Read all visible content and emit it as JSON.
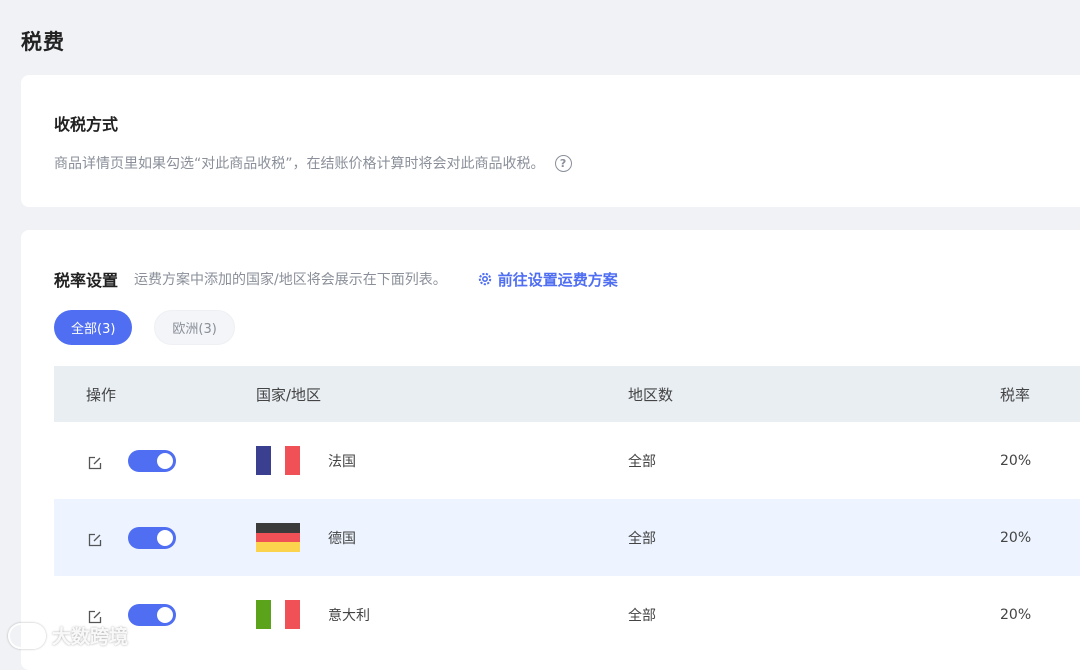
{
  "page": {
    "title": "税费"
  },
  "tax_method": {
    "title": "收税方式",
    "description": "商品详情页里如果勾选“对此商品收税”，在结账价格计算时将会对此商品收税。",
    "help_glyph": "?"
  },
  "tax_rate": {
    "title": "税率设置",
    "description": "运费方案中添加的国家/地区将会展示在下面列表。",
    "link_label": "前往设置运费方案",
    "tabs": [
      {
        "label": "全部(3)",
        "active": true
      },
      {
        "label": "欧洲(3)",
        "active": false
      }
    ],
    "table": {
      "headers": {
        "op": "操作",
        "country": "国家/地区",
        "region": "地区数",
        "rate": "税率"
      },
      "rows": [
        {
          "country": "法国",
          "region": "全部",
          "rate": "20%",
          "enabled": true,
          "flag": "france"
        },
        {
          "country": "德国",
          "region": "全部",
          "rate": "20%",
          "enabled": true,
          "flag": "germany"
        },
        {
          "country": "意大利",
          "region": "全部",
          "rate": "20%",
          "enabled": true,
          "flag": "italy"
        }
      ]
    }
  },
  "watermark": {
    "text": "大数跨境"
  },
  "colors": {
    "accent": "#4f6ef2",
    "background": "#f0f2f5",
    "header_bg": "#e9eef3",
    "highlight_row": "#edf4ff"
  }
}
